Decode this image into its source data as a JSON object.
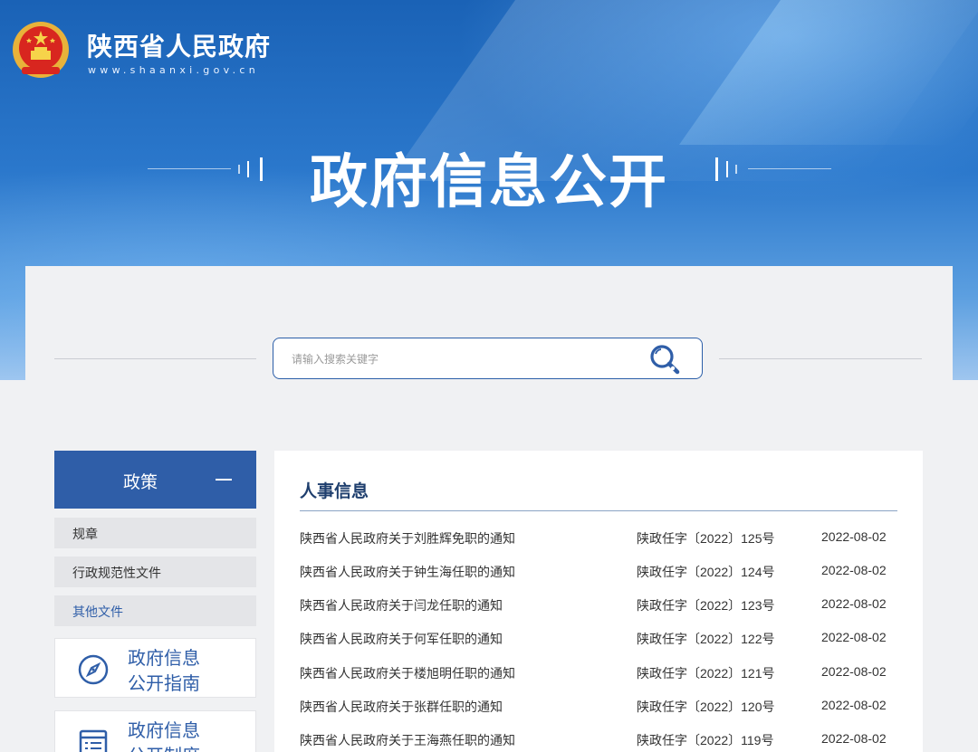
{
  "header": {
    "site_name": "陕西省人民政府",
    "site_url": "www.shaanxi.gov.cn",
    "hero_title": "政府信息公开",
    "emblem": "national-emblem-icon"
  },
  "search": {
    "placeholder": "请输入搜索关键字",
    "icon": "search-icon"
  },
  "sidebar": {
    "section_label": "政策",
    "items": [
      {
        "label": "规章"
      },
      {
        "label": "行政规范性文件"
      },
      {
        "label": "其他文件"
      }
    ],
    "quick_links": [
      {
        "line1": "政府信息",
        "line2": "公开指南",
        "icon": "compass-icon"
      },
      {
        "line1": "政府信息",
        "line2": "公开制度",
        "icon": "document-list-icon"
      }
    ]
  },
  "content": {
    "title": "人事信息",
    "rows": [
      {
        "title": "陕西省人民政府关于刘胜辉免职的通知",
        "doc_no": "陕政任字〔2022〕125号",
        "date": "2022-08-02"
      },
      {
        "title": "陕西省人民政府关于钟生海任职的通知",
        "doc_no": "陕政任字〔2022〕124号",
        "date": "2022-08-02"
      },
      {
        "title": "陕西省人民政府关于闫龙任职的通知",
        "doc_no": "陕政任字〔2022〕123号",
        "date": "2022-08-02"
      },
      {
        "title": "陕西省人民政府关于何军任职的通知",
        "doc_no": "陕政任字〔2022〕122号",
        "date": "2022-08-02"
      },
      {
        "title": "陕西省人民政府关于楼旭明任职的通知",
        "doc_no": "陕政任字〔2022〕121号",
        "date": "2022-08-02"
      },
      {
        "title": "陕西省人民政府关于张群任职的通知",
        "doc_no": "陕政任字〔2022〕120号",
        "date": "2022-08-02"
      },
      {
        "title": "陕西省人民政府关于王海燕任职的通知",
        "doc_no": "陕政任字〔2022〕119号",
        "date": "2022-08-02"
      }
    ]
  },
  "colors": {
    "primary": "#2f5ea8",
    "heading": "#1f3f6e"
  }
}
